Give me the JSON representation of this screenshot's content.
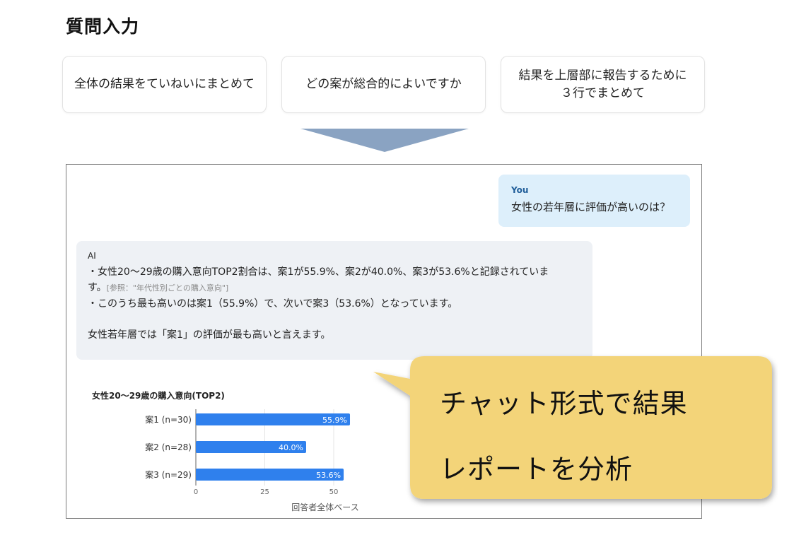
{
  "header": {
    "title": "質問入力"
  },
  "questions": [
    {
      "label": "全体の結果をていねいにまとめて"
    },
    {
      "label": "どの案が総合的によいですか"
    },
    {
      "label_line1": "結果を上層部に報告するために",
      "label_line2": "３行でまとめて"
    }
  ],
  "chat": {
    "user": {
      "name": "You",
      "message": "女性の若年層に評価が高いのは？"
    },
    "ai": {
      "name": "AI",
      "line1": "・女性20〜29歳の購入意向TOP2割合は、案1が55.9%、案2が40.0%、案3が53.6%と記録されていま",
      "line2": "す。",
      "reference": "[参照：\"年代性別ごとの購入意向\"]",
      "line3": "・このうち最も高いのは案1（55.9%）で、次いで案3（53.6%）となっています。",
      "line4": "女性若年層では「案1」の評価が最も高いと言えます。"
    }
  },
  "callout": {
    "line1": "チャット形式で結果",
    "line2": "レポートを分析",
    "color": "#f3d479"
  },
  "colors": {
    "bar": "#2f80ed",
    "user_bubble": "#ddeffb",
    "ai_bubble": "#eef1f5",
    "arrow": "#8aa3c2"
  },
  "chart_data": {
    "type": "bar",
    "orientation": "horizontal",
    "title": "女性20〜29歳の購入意向(TOP2)",
    "categories": [
      "案1 (n=30)",
      "案2 (n=28)",
      "案3 (n=29)"
    ],
    "values": [
      55.9,
      40.0,
      53.6
    ],
    "value_labels": [
      "55.9%",
      "40.0%",
      "53.6%"
    ],
    "xticks": [
      "0",
      "25",
      "50"
    ],
    "xlim": [
      0,
      100
    ],
    "xlabel": "回答者全体ベース",
    "grid": true
  }
}
